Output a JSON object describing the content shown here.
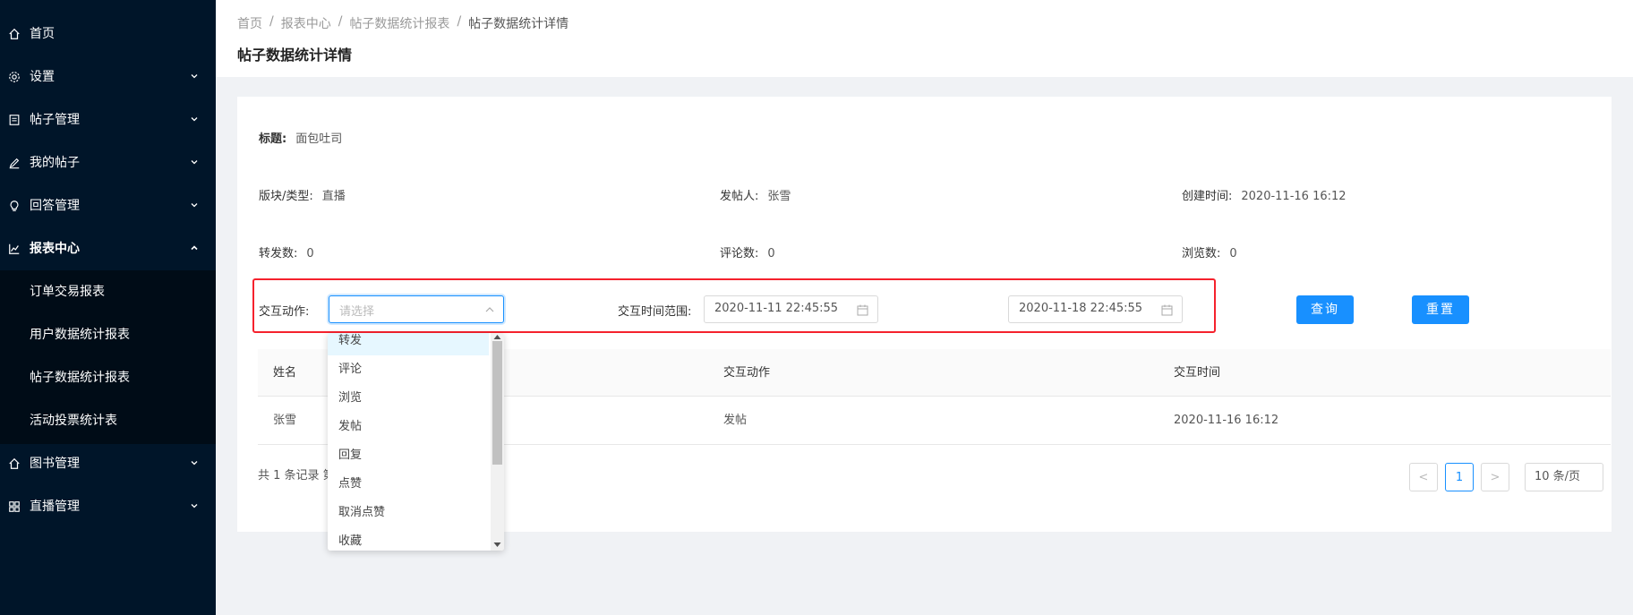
{
  "sidebar": {
    "items": [
      {
        "label": "首页",
        "icon": "home-icon"
      },
      {
        "label": "设置",
        "icon": "gear-icon"
      },
      {
        "label": "帖子管理",
        "icon": "document-icon"
      },
      {
        "label": "我的帖子",
        "icon": "pen-icon"
      },
      {
        "label": "回答管理",
        "icon": "bulb-icon"
      },
      {
        "label": "报表中心",
        "icon": "chart-icon"
      },
      {
        "label": "图书管理",
        "icon": "home-icon"
      },
      {
        "label": "直播管理",
        "icon": "grid-icon"
      }
    ],
    "submenu": [
      "订单交易报表",
      "用户数据统计报表",
      "帖子数据统计报表",
      "活动投票统计表"
    ]
  },
  "header": {
    "breadcrumb": [
      "首页",
      "报表中心",
      "帖子数据统计报表",
      "帖子数据统计详情"
    ],
    "separator": "/",
    "title": "帖子数据统计详情"
  },
  "detail": {
    "title_label": "标题:",
    "title_value": "面包吐司",
    "section_label": "版块/类型:",
    "section_value": "直播",
    "poster_label": "发帖人:",
    "poster_value": "张雪",
    "created_label": "创建时间:",
    "created_value": "2020-11-16 16:12",
    "reposts_label": "转发数:",
    "reposts_value": "0",
    "comments_label": "评论数:",
    "comments_value": "0",
    "views_label": "浏览数:",
    "views_value": "0"
  },
  "filter": {
    "action_label": "交互动作:",
    "action_placeholder": "请选择",
    "range_label": "交互时间范围:",
    "start_date": "2020-11-11 22:45:55",
    "end_date": "2020-11-18 22:45:55",
    "query_button": "查询",
    "reset_button": "重置"
  },
  "dropdown": {
    "options": [
      "转发",
      "评论",
      "浏览",
      "发帖",
      "回复",
      "点赞",
      "取消点赞",
      "收藏"
    ],
    "highlighted": "转发"
  },
  "table": {
    "columns": [
      "姓名",
      "交互动作",
      "交互时间"
    ],
    "rows": [
      [
        "张雪",
        "发帖",
        "2020-11-16 16:12"
      ]
    ]
  },
  "pagination": {
    "total_text": "共 1 条记录 第",
    "current_page": "1",
    "prev": "<",
    "next": ">",
    "page_size": "10 条/页"
  },
  "colors": {
    "sidebar_bg": "#001529",
    "submenu_bg": "#000c17",
    "primary": "#1890ff",
    "highlight_border": "#f5222d"
  }
}
